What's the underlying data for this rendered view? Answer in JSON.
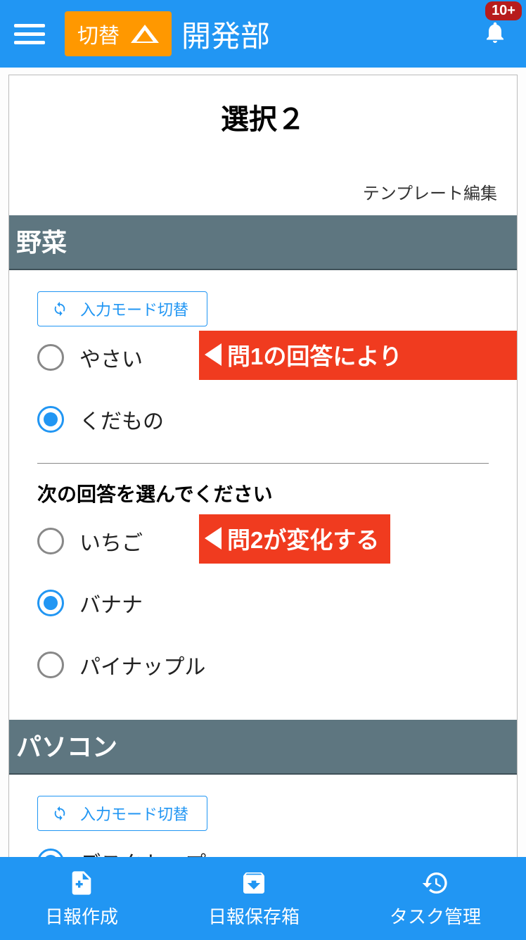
{
  "header": {
    "switch_label": "切替",
    "title": "開発部",
    "badge": "10+"
  },
  "page": {
    "title": "選択２",
    "template_edit": "テンプレート編集"
  },
  "sections": [
    {
      "heading": "野菜",
      "mode_switch_label": "入力モード切替",
      "group1": [
        {
          "label": "やさい",
          "checked": false
        },
        {
          "label": "くだもの",
          "checked": true
        }
      ],
      "sub_prompt": "次の回答を選んでください",
      "group2": [
        {
          "label": "いちご",
          "checked": false
        },
        {
          "label": "バナナ",
          "checked": true
        },
        {
          "label": "パイナップル",
          "checked": false
        }
      ]
    },
    {
      "heading": "パソコン",
      "mode_switch_label": "入力モード切替",
      "group1": [
        {
          "label": "デスクトップ",
          "checked": true
        }
      ]
    }
  ],
  "callouts": {
    "c1": "問1の回答により",
    "c2": "問2が変化する"
  },
  "bottom_nav": {
    "create": "日報作成",
    "inbox": "日報保存箱",
    "tasks": "タスク管理"
  }
}
